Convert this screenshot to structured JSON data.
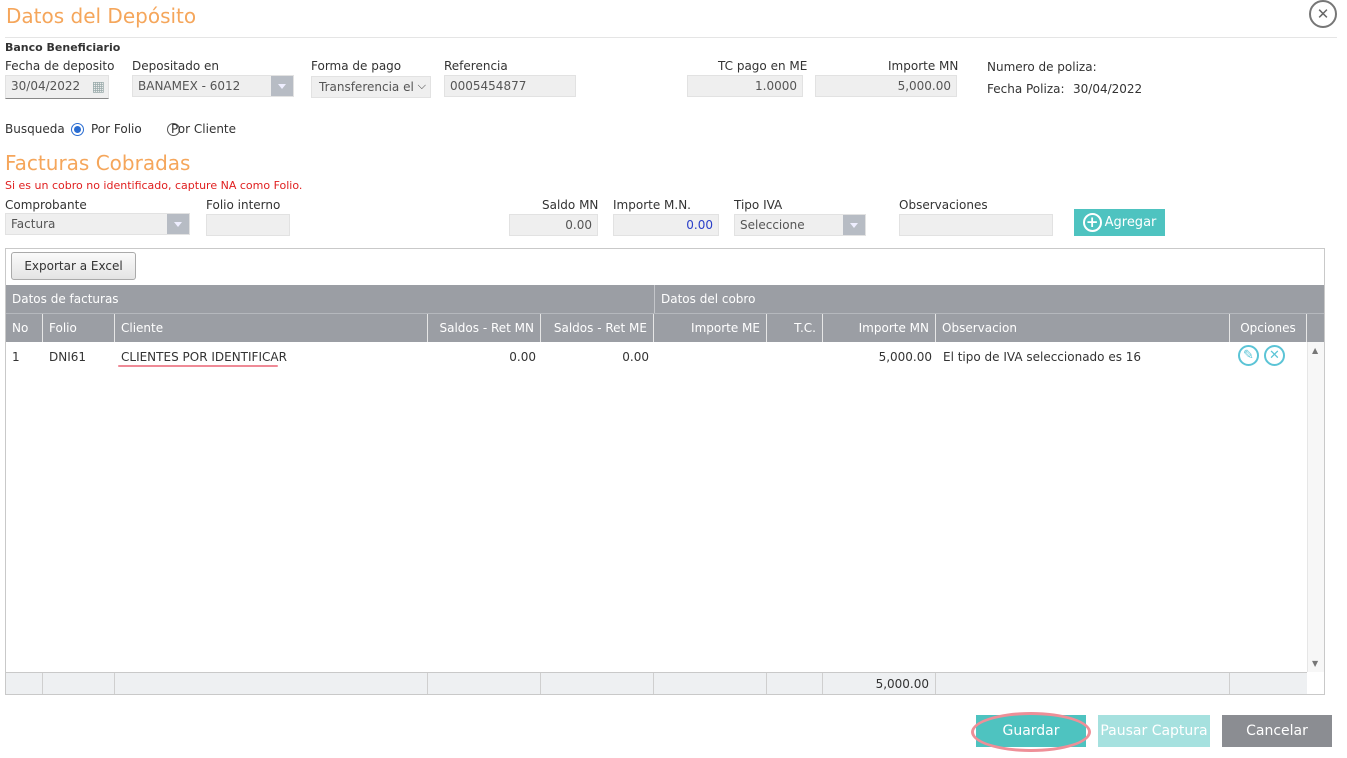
{
  "dialog": {
    "title": "Datos del Depósito",
    "close_icon": "close-icon"
  },
  "banco": {
    "section_label": "Banco Beneficiario"
  },
  "deposit": {
    "fecha_label": "Fecha de deposito",
    "fecha_value": "30/04/2022",
    "depositado_label": "Depositado en",
    "depositado_value": "BANAMEX - 6012",
    "forma_label": "Forma de pago",
    "forma_value": "Transferencia el",
    "referencia_label": "Referencia",
    "referencia_value": "0005454877",
    "tc_label": "TC pago en ME",
    "tc_value": "1.0000",
    "importe_label": "Importe MN",
    "importe_value": "5,000.00",
    "poliza_label": "Numero de poliza:",
    "fecha_poliza_label": "Fecha Poliza:",
    "fecha_poliza_value": "30/04/2022"
  },
  "busqueda": {
    "label": "Busqueda",
    "options": [
      {
        "label": "Por Folio",
        "selected": true
      },
      {
        "label": "Por Cliente",
        "selected": false
      }
    ]
  },
  "facturas": {
    "title": "Facturas Cobradas",
    "warning": "Si es un cobro no identificado, capture NA como Folio.",
    "comprobante_label": "Comprobante",
    "comprobante_value": "Factura",
    "folio_label": "Folio interno",
    "folio_value": "",
    "saldo_label": "Saldo MN",
    "saldo_value": "0.00",
    "importe_label": "Importe M.N.",
    "importe_value": "0.00",
    "tipo_iva_label": "Tipo IVA",
    "tipo_iva_value": "Seleccione",
    "observaciones_label": "Observaciones",
    "observaciones_value": "",
    "agregar_label": "Agregar"
  },
  "grid": {
    "export_label": "Exportar a Excel",
    "group_headers": [
      "Datos de facturas",
      "Datos del cobro"
    ],
    "columns": [
      "No",
      "Folio",
      "Cliente",
      "Saldos - Ret MN",
      "Saldos - Ret ME",
      "Importe ME",
      "T.C.",
      "Importe MN",
      "Observacion",
      "Opciones"
    ],
    "rows": [
      {
        "no": "1",
        "folio": "DNI61",
        "cliente": "CLIENTES POR IDENTIFICAR",
        "saldo_mn": "0.00",
        "saldo_me": "0.00",
        "importe_me": "",
        "tc": "",
        "importe_mn": "5,000.00",
        "observacion": "El tipo de IVA seleccionado es 16"
      }
    ],
    "footer_total": "5,000.00"
  },
  "actions": {
    "guardar": "Guardar",
    "pausar": "Pausar Captura",
    "cancelar": "Cancelar"
  },
  "colors": {
    "accent_orange": "#f5a65b",
    "teal": "#4ec3c0",
    "header_gray": "#9b9ea4",
    "warning_red": "#e02020",
    "cancel_gray": "#8b8d92"
  }
}
